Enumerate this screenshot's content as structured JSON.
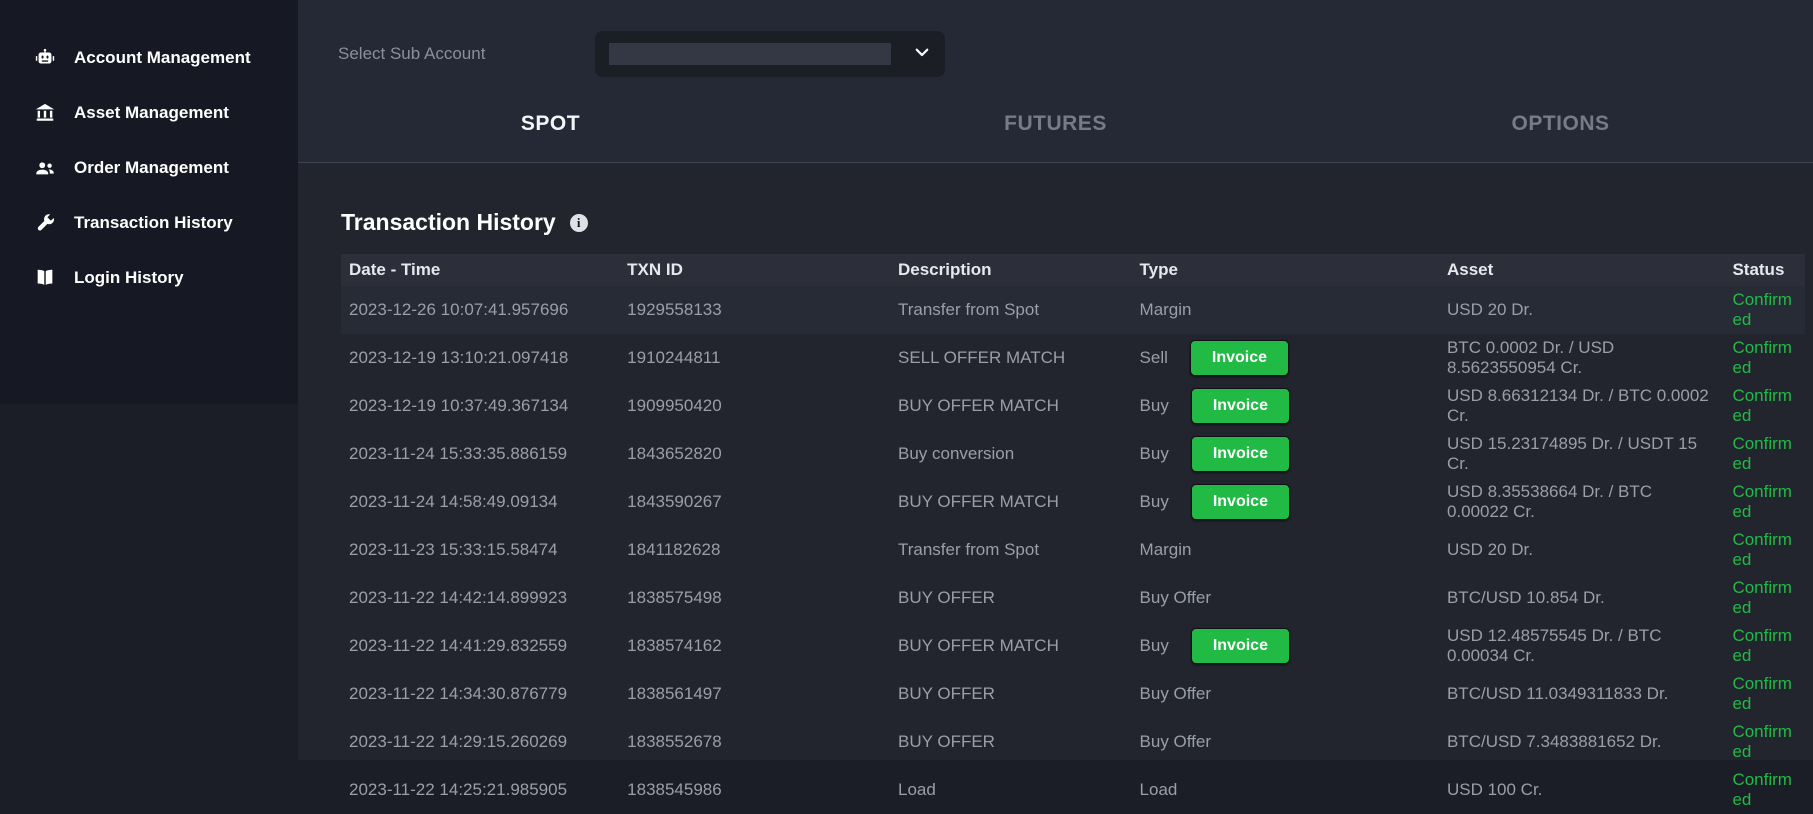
{
  "sidebar": {
    "items": [
      {
        "label": "Account Management",
        "icon": "robot-icon"
      },
      {
        "label": "Asset Management",
        "icon": "bank-icon"
      },
      {
        "label": "Order Management",
        "icon": "users-icon"
      },
      {
        "label": "Transaction History",
        "icon": "wrench-icon"
      },
      {
        "label": "Login History",
        "icon": "open-book-icon"
      }
    ]
  },
  "topbar": {
    "select_sub_account_label": "Select Sub Account",
    "selected_value": ""
  },
  "tabs": [
    {
      "label": "SPOT",
      "active": true
    },
    {
      "label": "FUTURES",
      "active": false
    },
    {
      "label": "OPTIONS",
      "active": false
    }
  ],
  "section": {
    "title": "Transaction History",
    "info_glyph": "i"
  },
  "buttons": {
    "invoice_label": "Invoice"
  },
  "table": {
    "headers": [
      "Date - Time",
      "TXN ID",
      "Description",
      "Type",
      "Asset",
      "Status"
    ],
    "rows": [
      {
        "datetime": "2023-12-26 10:07:41.957696",
        "txn_id": "1929558133",
        "description": "Transfer from Spot",
        "type": "Margin",
        "invoice": false,
        "asset": "USD 20 Dr.",
        "status": "Confirmed",
        "highlight": true
      },
      {
        "datetime": "2023-12-19 13:10:21.097418",
        "txn_id": "1910244811",
        "description": "SELL OFFER MATCH",
        "type": "Sell",
        "invoice": true,
        "asset": "BTC 0.0002 Dr. / USD 8.5623550954 Cr.",
        "status": "Confirmed",
        "highlight": false
      },
      {
        "datetime": "2023-12-19 10:37:49.367134",
        "txn_id": "1909950420",
        "description": "BUY OFFER MATCH",
        "type": "Buy",
        "invoice": true,
        "asset": "USD 8.66312134 Dr. / BTC 0.0002 Cr.",
        "status": "Confirmed",
        "highlight": false
      },
      {
        "datetime": "2023-11-24 15:33:35.886159",
        "txn_id": "1843652820",
        "description": "Buy conversion",
        "type": "Buy",
        "invoice": true,
        "asset": "USD 15.23174895 Dr. / USDT 15 Cr.",
        "status": "Confirmed",
        "highlight": false
      },
      {
        "datetime": "2023-11-24 14:58:49.09134",
        "txn_id": "1843590267",
        "description": "BUY OFFER MATCH",
        "type": "Buy",
        "invoice": true,
        "asset": "USD 8.35538664 Dr. / BTC 0.00022 Cr.",
        "status": "Confirmed",
        "highlight": false
      },
      {
        "datetime": "2023-11-23 15:33:15.58474",
        "txn_id": "1841182628",
        "description": "Transfer from Spot",
        "type": "Margin",
        "invoice": false,
        "asset": "USD 20 Dr.",
        "status": "Confirmed",
        "highlight": false
      },
      {
        "datetime": "2023-11-22 14:42:14.899923",
        "txn_id": "1838575498",
        "description": "BUY OFFER",
        "type": "Buy Offer",
        "invoice": false,
        "asset": "BTC/USD 10.854 Dr.",
        "status": "Confirmed",
        "highlight": false
      },
      {
        "datetime": "2023-11-22 14:41:29.832559",
        "txn_id": "1838574162",
        "description": "BUY OFFER MATCH",
        "type": "Buy",
        "invoice": true,
        "asset": "USD 12.48575545 Dr. / BTC 0.00034 Cr.",
        "status": "Confirmed",
        "highlight": false
      },
      {
        "datetime": "2023-11-22 14:34:30.876779",
        "txn_id": "1838561497",
        "description": "BUY OFFER",
        "type": "Buy Offer",
        "invoice": false,
        "asset": "BTC/USD 11.0349311833 Dr.",
        "status": "Confirmed",
        "highlight": false
      },
      {
        "datetime": "2023-11-22 14:29:15.260269",
        "txn_id": "1838552678",
        "description": "BUY OFFER",
        "type": "Buy Offer",
        "invoice": false,
        "asset": "BTC/USD 7.3483881652 Dr.",
        "status": "Confirmed",
        "highlight": false
      },
      {
        "datetime": "2023-11-22 14:25:21.985905",
        "txn_id": "1838545986",
        "description": "Load",
        "type": "Load",
        "invoice": false,
        "asset": "USD 100 Cr.",
        "status": "Confirmed",
        "highlight": false
      }
    ]
  },
  "colors": {
    "sidebar_bg": "#161823",
    "top_bg": "#252935",
    "content_bg": "#22252e",
    "table_header_bg": "#2c2f39",
    "accent_green": "#21ba45",
    "muted_text": "#9b9ea7"
  }
}
